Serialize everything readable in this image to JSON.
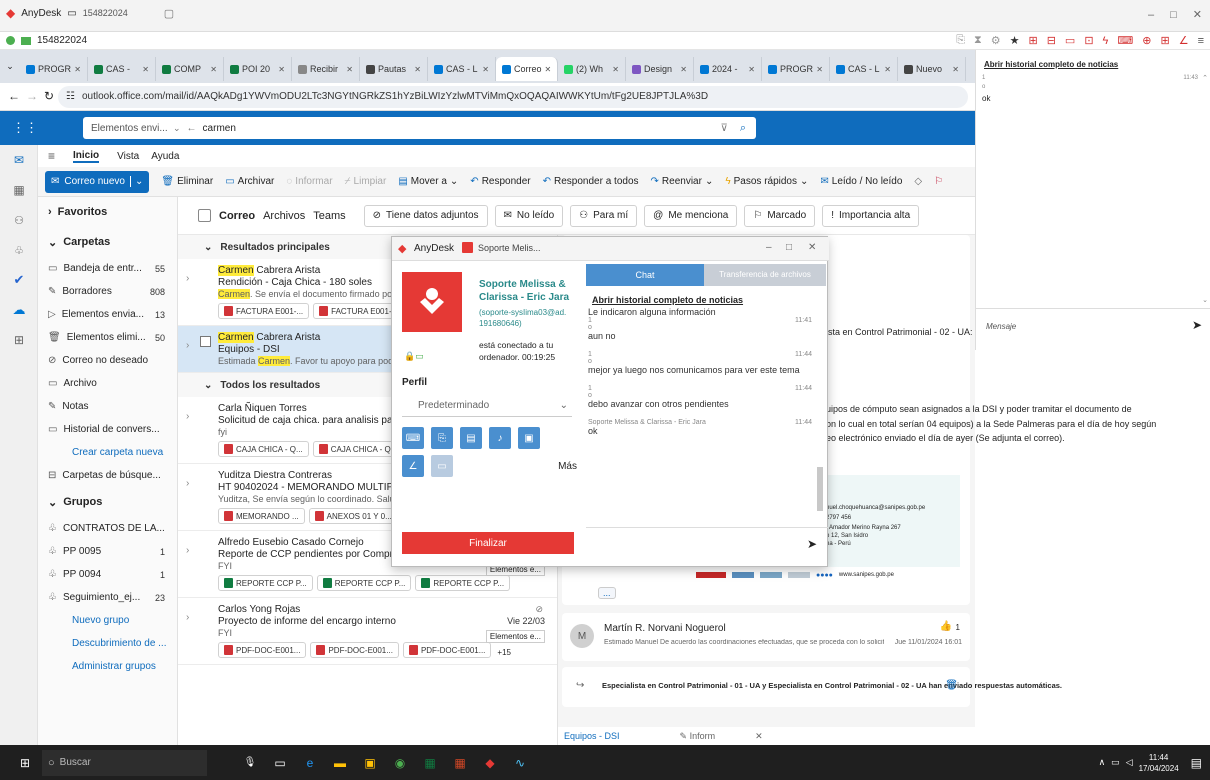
{
  "anydesk": {
    "app": "AnyDesk",
    "session_id": "154822024",
    "address": "154822024",
    "side_title": "Abrir historial completo de noticias",
    "side_meta": "1",
    "side_time": "11:43",
    "side_o": "o",
    "side_msg": "ok",
    "side_input": "Mensaje"
  },
  "browser": {
    "tabs": [
      "PROGR",
      "CAS -",
      "COMP",
      "POI 20",
      "Recibir",
      "Pautas",
      "CAS - L",
      "Correo",
      "(2) Wh",
      "Design",
      "2024 -",
      "PROGR",
      "CAS - L",
      "Nuevo"
    ],
    "url": "outlook.office.com/mail/id/AAQkADg1YWVmODU2LTc3NGYtNGRkZS1hYzBiLWIzYzlwMTViMmQxOQAQAIWWKYtUm/tFg2UE8JPTJLA%3D"
  },
  "outlook": {
    "search_scope": "Elementos envi...",
    "search_query": "carmen",
    "menu": [
      "Inicio",
      "Vista",
      "Ayuda"
    ],
    "ribbon": {
      "new": "Correo nuevo",
      "delete": "Eliminar",
      "archive": "Archivar",
      "report": "Informar",
      "clean": "Limpiar",
      "move": "Mover a",
      "reply": "Responder",
      "reply_all": "Responder a todos",
      "forward": "Reenviar",
      "quick": "Pasos rápidos",
      "read": "Leído / No leído"
    },
    "filters": {
      "tabs": [
        "Correo",
        "Archivos",
        "Teams"
      ],
      "chips": [
        "Tiene datos adjuntos",
        "No leído",
        "Para mí",
        "Me menciona",
        "Marcado",
        "Importancia alta"
      ]
    },
    "folders": [
      {
        "label": "Favoritos",
        "count": ""
      },
      {
        "label": "Carpetas",
        "count": ""
      },
      {
        "label": "Bandeja de entr...",
        "count": "55"
      },
      {
        "label": "Borradores",
        "count": "808"
      },
      {
        "label": "Elementos envia...",
        "count": "13"
      },
      {
        "label": "Elementos elimi...",
        "count": "50"
      },
      {
        "label": "Correo no deseado",
        "count": ""
      },
      {
        "label": "Archivo",
        "count": ""
      },
      {
        "label": "Notas",
        "count": ""
      },
      {
        "label": "Historial de convers...",
        "count": ""
      },
      {
        "label": "Crear carpeta nueva",
        "count": ""
      },
      {
        "label": "Carpetas de búsque...",
        "count": ""
      },
      {
        "label": "Grupos",
        "count": ""
      },
      {
        "label": "CONTRATOS DE LA...",
        "count": ""
      },
      {
        "label": "PP 0095",
        "count": "1"
      },
      {
        "label": "PP 0094",
        "count": "1"
      },
      {
        "label": "Seguimiento_ej...",
        "count": "23"
      },
      {
        "label": "Nuevo grupo",
        "count": ""
      },
      {
        "label": "Descubrimiento de ...",
        "count": ""
      },
      {
        "label": "Administrar grupos",
        "count": ""
      }
    ],
    "sections": [
      "Resultados principales",
      "Todos los resultados"
    ],
    "mails": [
      {
        "hl": "Carmen",
        "from": " Cabrera Arista",
        "subject": "Rendición - Caja Chica - 180 soles",
        "preview_hl": "Carmen",
        "preview": ". Se envía el documento firmado por",
        "att": [
          "FACTURA E001-...",
          "FACTURA E001-..."
        ],
        "date": "",
        "tag": ""
      },
      {
        "hl": "Carmen",
        "from": " Cabrera Arista",
        "subject": "Equipos - DSI",
        "preview_pre": "Estimada ",
        "preview_hl": "Carmen",
        "preview": ". Favor tu apoyo para pode",
        "att": [],
        "date": "",
        "tag": ""
      },
      {
        "from": "Carla Ñiquen Torres",
        "subject": "Solicitud de caja chica. para analisis parasito",
        "preview": "fyi",
        "att": [
          "CAJA CHICA - Q...",
          "CAJA CHICA - Q..."
        ],
        "date": "",
        "tag": ""
      },
      {
        "from": "Yuditza Diestra Contreras",
        "subject": "HT 90402024 - MEMORANDO MULTIPLE N°",
        "preview": "Yuditza, Se envía según lo coordinado. Salud",
        "att": [
          "MEMORANDO ...",
          "ANEXOS 01 Y 0..."
        ],
        "date": "",
        "tag": ""
      },
      {
        "from": "Alfredo Eusebio Casado Cornejo",
        "subject": "Reporte de CCP pendientes por Comprometer y Devengar",
        "preview": "FYI",
        "att": [
          "REPORTE CCP P...",
          "REPORTE CCP P...",
          "REPORTE CCP P..."
        ],
        "date": "Mié 27/03",
        "tag": "Elementos e..."
      },
      {
        "from": "Carlos Yong Rojas",
        "subject": "Proyecto de informe del encargo interno",
        "preview": "FYI",
        "att": [
          "PDF-DOC-E001...",
          "PDF-DOC-E001...",
          "PDF-DOC-E001..."
        ],
        "more": "+15",
        "date": "Vie 22/03",
        "tag": "Elementos e..."
      }
    ],
    "reading": {
      "frag1": "ista en Control Patrimonial - 02 - UA: J",
      "frag2": "uipos de cómputo sean asignados a la DSI y poder tramitar el documento de",
      "frag3": "on lo cual en total serían 04 equipos) a la Sede Palmeras para el día de hoy según",
      "frag4": "eo electrónico enviado el día de ayer (Se adjunta el correo).",
      "sig1": "nuel.choquehuanca@sanipes.gob.pe",
      "sig2": "2797 456",
      "sig3": ". Amador Merino Rayna 267",
      "sig4": "o 12, San Isidro",
      "sig5": "na - Perú",
      "sig_web": "www.sanipes.gob.pe",
      "dots": "...",
      "reply_avatar": "M",
      "reply_from": "Martín R. Norvani Noguerol",
      "reply_body": "Estimado Manuel De acuerdo las coordinaciones efectuadas, que se proceda con lo solicitado Saludos cordiales Martin Norvani",
      "reply_date": "Jue 11/01/2024 16:01",
      "likes": "1",
      "auto": "Especialista en Control Patrimonial - 01 - UA y Especialista en Control Patrimonial - 02 - UA han enviado respuestas automáticas.",
      "tab1": "Equipos - DSI",
      "tab2": "Inform"
    }
  },
  "dialog": {
    "app": "AnyDesk",
    "tab": "Soporte Melis...",
    "name": "Soporte Melissa & Clarissa - Eric Jara",
    "contact": "(soporte-sysIima03@ad. 191680646)",
    "status": "está conectado a tu ordenador. 00:19:25",
    "profile_label": "Perfil",
    "profile_value": "Predeterminado",
    "more": "Más",
    "end": "Finalizar",
    "tab_chat": "Chat",
    "tab_files": "Transferencia de archivos",
    "history": "Abrir historial completo de noticias",
    "messages": [
      {
        "pre": "Le indicaron alguna información",
        "meta": "1",
        "o": "o",
        "time": "11:41",
        "text": "aun no"
      },
      {
        "meta": "1",
        "o": "o",
        "time": "11:44",
        "text": "mejor ya luego nos comunicamos para ver este tema"
      },
      {
        "meta": "1",
        "o": "o",
        "time": "11:44",
        "text": "debo avanzar con otros pendientes"
      },
      {
        "meta": "Soporte Melissa & Clarissa - Eric Jara",
        "time": "11:44",
        "text": "ok"
      }
    ]
  },
  "taskbar": {
    "search": "Buscar",
    "time": "11:44",
    "date": "17/04/2024"
  }
}
